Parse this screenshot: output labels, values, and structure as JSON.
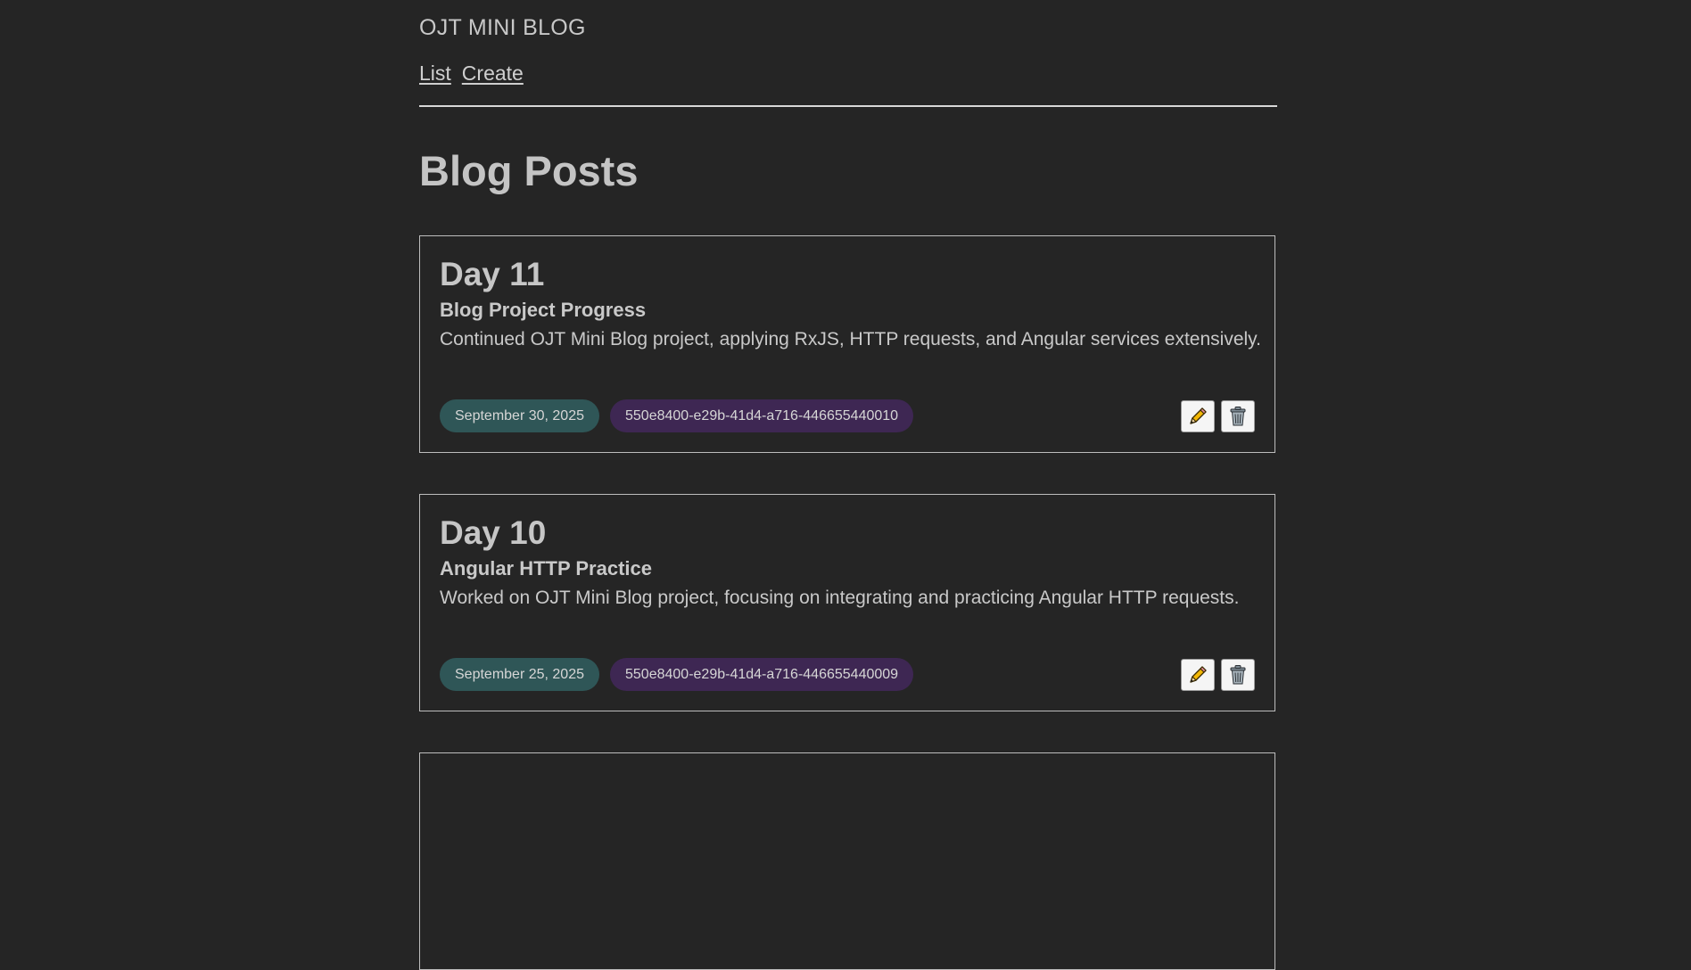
{
  "site": {
    "title": "OJT MINI BLOG"
  },
  "nav": {
    "list_label": "List",
    "create_label": "Create"
  },
  "page": {
    "title": "Blog Posts"
  },
  "posts": [
    {
      "day": "Day 11",
      "subtitle": "Blog Project Progress",
      "description": "Continued OJT Mini Blog project, applying RxJS, HTTP requests, and Angular services extensively.",
      "date": "September 30, 2025",
      "id": "550e8400-e29b-41d4-a716-446655440010",
      "edit_icon": "pencil-icon",
      "delete_icon": "trash-icon"
    },
    {
      "day": "Day 10",
      "subtitle": "Angular HTTP Practice",
      "description": "Worked on OJT Mini Blog project, focusing on integrating and practicing Angular HTTP requests.",
      "date": "September 25, 2025",
      "id": "550e8400-e29b-41d4-a716-446655440009",
      "edit_icon": "pencil-icon",
      "delete_icon": "trash-icon"
    }
  ],
  "colors": {
    "background": "#252525",
    "date_badge": "#2f5657",
    "id_badge": "#3e2753",
    "card_border": "#bdbdbd"
  }
}
